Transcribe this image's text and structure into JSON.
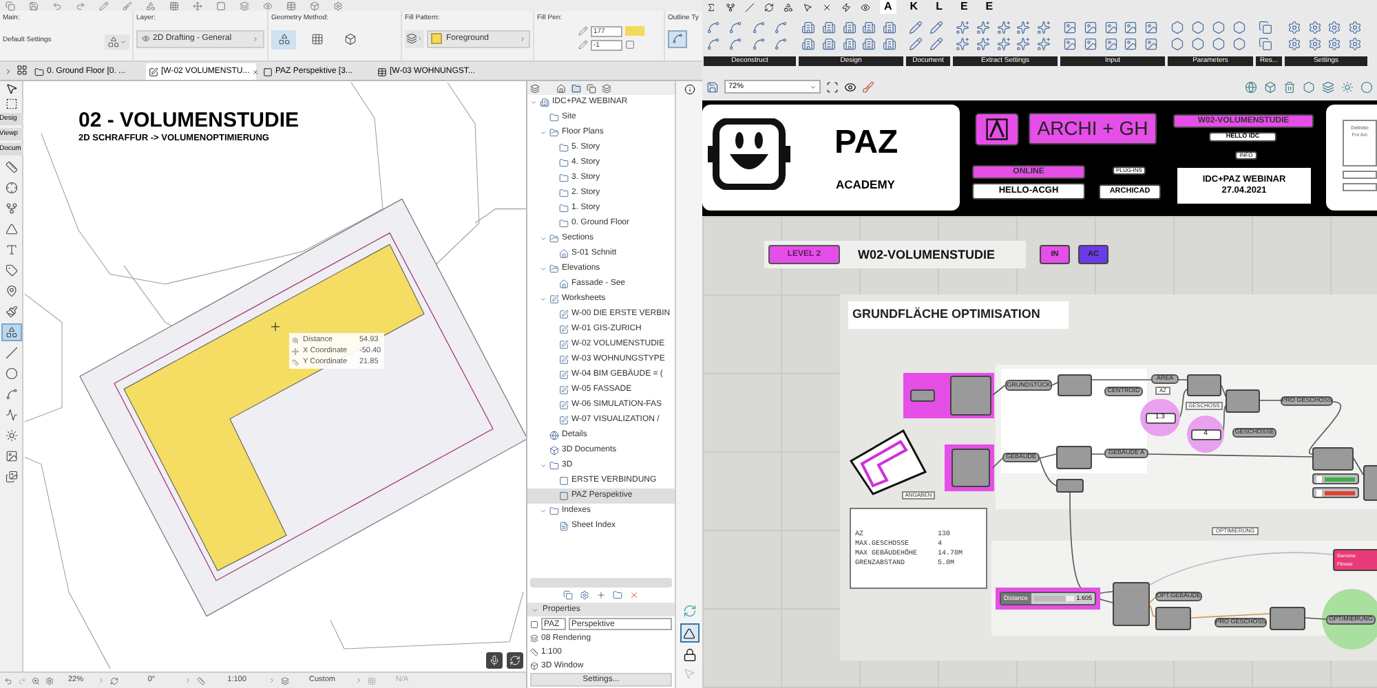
{
  "archicad": {
    "info_box": {
      "main_label": "Main:",
      "main_value": "Default Settings",
      "layer_label": "Layer:",
      "layer_value": "2D Drafting - General",
      "geometry_label": "Geometry Method:",
      "geometry_methods": [
        {
          "selected": true
        },
        {
          "selected": false
        },
        {
          "selected": false
        }
      ],
      "fill_pattern_label": "Fill Pattern:",
      "fill_pattern_value": "Foreground",
      "fill_pen_label": "Fill Pen:",
      "fill_pen": "177",
      "background_pen": "-1",
      "outline_label": "Outline Ty"
    },
    "tabs": [
      {
        "label": "0. Ground Floor [0. ...",
        "kind": "plan",
        "selected": false
      },
      {
        "label": "[W-02 VOLUMENSTU...",
        "kind": "worksheet",
        "selected": true
      },
      {
        "label": "PAZ Perspektive [3...",
        "kind": "view3d",
        "selected": false
      },
      {
        "label": "[W-03 WOHNUNGST...",
        "kind": "table",
        "selected": false
      }
    ],
    "toolbox": {
      "sections": [
        "Desig",
        "Viewp",
        "Docum"
      ],
      "tools": [
        {
          "selected": false
        },
        {
          "selected": false
        },
        {
          "selected": false
        },
        {
          "selected": false
        },
        {
          "selected": false
        },
        {
          "selected": false
        },
        {
          "selected": false
        },
        {
          "selected": false
        },
        {
          "selected": true
        },
        {
          "selected": false
        },
        {
          "selected": false
        },
        {
          "selected": false
        },
        {
          "selected": false
        },
        {
          "selected": false
        },
        {
          "selected": false
        },
        {
          "selected": false
        }
      ]
    },
    "drawing": {
      "title": "02 - VOLUMENSTUDIE",
      "subtitle": "2D SCHRAFFUR -> VOLUMENOPTIMIERUNG"
    },
    "tracker": [
      {
        "label": "Distance",
        "value": "54.93"
      },
      {
        "label": "X Coordinate",
        "value": "-50.40"
      },
      {
        "label": "Y Coordinate",
        "value": "21.85"
      }
    ],
    "status_bar": {
      "zoom": "22%",
      "angle": "0°",
      "scale": "1:100",
      "custom": "Custom",
      "na": "N/A"
    }
  },
  "navigator": {
    "tree": [
      {
        "label": "IDC+PAZ WEBINAR",
        "kind": "project",
        "expanded": true,
        "selected": false,
        "children": [
          {
            "label": "Site",
            "kind": "story",
            "selected": false
          },
          {
            "label": "Floor Plans",
            "kind": "group",
            "expanded": true,
            "selected": false,
            "children": [
              {
                "label": "5. Story",
                "kind": "story",
                "selected": false
              },
              {
                "label": "4. Story",
                "kind": "story",
                "selected": false
              },
              {
                "label": "3. Story",
                "kind": "story",
                "selected": false
              },
              {
                "label": "2. Story",
                "kind": "story",
                "selected": false
              },
              {
                "label": "1. Story",
                "kind": "story",
                "selected": false
              },
              {
                "label": "0. Ground Floor",
                "kind": "story",
                "selected": false
              }
            ]
          },
          {
            "label": "Sections",
            "kind": "group",
            "expanded": true,
            "selected": false,
            "children": [
              {
                "label": "S-01 Schnitt",
                "kind": "section",
                "selected": false
              }
            ]
          },
          {
            "label": "Elevations",
            "kind": "group",
            "expanded": true,
            "selected": false,
            "children": [
              {
                "label": "Fassade - See",
                "kind": "elevation",
                "selected": false
              }
            ]
          },
          {
            "label": "Worksheets",
            "kind": "worksheets",
            "expanded": true,
            "selected": false,
            "children": [
              {
                "label": "W-00 DIE ERSTE VERBIN",
                "kind": "worksheet",
                "selected": false
              },
              {
                "label": "W-01 GIS-ZURICH",
                "kind": "worksheet",
                "selected": false
              },
              {
                "label": "W-02 VOLUMENSTUDIE",
                "kind": "worksheet",
                "selected": false
              },
              {
                "label": "W-03 WOHNUNGSTYPE",
                "kind": "worksheet",
                "selected": false
              },
              {
                "label": "W-04 BIM GEBÄUDE = (",
                "kind": "worksheet",
                "selected": false
              },
              {
                "label": "W-05 FASSADE",
                "kind": "worksheet",
                "selected": false
              },
              {
                "label": "W-06 SIMULATION-FAS",
                "kind": "worksheet",
                "selected": false
              },
              {
                "label": "W-07 VISUALIZATION /",
                "kind": "worksheet",
                "selected": false
              }
            ]
          },
          {
            "label": "Details",
            "kind": "detail",
            "selected": false
          },
          {
            "label": "3D Documents",
            "kind": "doc3d",
            "selected": false
          },
          {
            "label": "3D",
            "kind": "folder",
            "expanded": true,
            "selected": false,
            "children": [
              {
                "label": "ERSTE VERBINDUNG",
                "kind": "view3d",
                "selected": false
              },
              {
                "label": "PAZ Perspektive",
                "kind": "view3d",
                "selected": true
              }
            ]
          },
          {
            "label": "Indexes",
            "kind": "folder",
            "expanded": true,
            "selected": false,
            "children": [
              {
                "label": "Sheet Index",
                "kind": "index",
                "selected": false
              }
            ]
          }
        ]
      }
    ],
    "properties": {
      "title": "Properties",
      "id": "PAZ",
      "name": "Perspektive",
      "rows": [
        "08 Rendering",
        "1:100",
        "3D Window"
      ],
      "settings_button": "Settings..."
    }
  },
  "grasshopper": {
    "tabs": [
      {
        "label": "A",
        "selected": true
      },
      {
        "label": "K",
        "selected": false
      },
      {
        "label": "L",
        "selected": false
      },
      {
        "label": "E",
        "selected": false
      },
      {
        "label": "E",
        "selected": false
      }
    ],
    "ribbon_groups": [
      "Deconstruct",
      "Design",
      "Document",
      "Extract Settings",
      "Input",
      "Parameters",
      "Res...",
      "Settings"
    ],
    "zoom": "72%",
    "banner": {
      "brand": "PAZ",
      "brand_sub": "ACADEMY",
      "archi": "ARCHI + GH",
      "study": "W02-VOLUMENSTUDIE",
      "hello_idc": "HELLO IDC",
      "info": "INFO",
      "online": "ONLINE",
      "hello_acgh": "HELLO-ACGH",
      "plugins": "PLUG-INS",
      "archicad": "ARCHICAD",
      "webinar": "IDC+PAZ WEBINAR",
      "date": "27.04.2021",
      "side_note_1": "Definitio",
      "side_note_2": "For Arc"
    },
    "header": {
      "level": "LEVEL 2",
      "title": "W02-VOLUMENSTUDIE",
      "tags": [
        {
          "label": "IN",
          "color": "#e64ee8"
        },
        {
          "label": "AC",
          "color": "#6a3be6"
        }
      ]
    },
    "group_title": "GRUNDFLÄCHE OPTIMISATION",
    "params": [
      {
        "kind": "tag",
        "text": "GRUNDSTÜCK"
      },
      {
        "kind": "tag",
        "text": "CENTROID"
      },
      {
        "kind": "tag",
        "text": "AREA"
      },
      {
        "kind": "note",
        "text": "AZ"
      },
      {
        "kind": "value",
        "text": "1.3"
      },
      {
        "kind": "note",
        "text": "GESCHOSS"
      },
      {
        "kind": "value",
        "text": "4"
      },
      {
        "kind": "tag",
        "text": "GESCHOSSE"
      },
      {
        "kind": "tag",
        "text": "PRO GESCHOSS"
      },
      {
        "kind": "tag",
        "text": "GEBÄUDE"
      },
      {
        "kind": "tag",
        "text": "GEBÄUDE A"
      },
      {
        "kind": "note",
        "text": "ANGABEN"
      },
      {
        "kind": "note",
        "text": "OPTIMIERUNG"
      },
      {
        "kind": "tag",
        "text": "OPT.GEBÄUDE"
      },
      {
        "kind": "tag",
        "text": "PRO GESCHOSS"
      },
      {
        "kind": "tag",
        "text": "OPTIMIERUNG"
      }
    ],
    "panel_lines": [
      {
        "key": "AZ",
        "value": "130"
      },
      {
        "key": "MAX.GESCHOSSE",
        "value": "4"
      },
      {
        "key": "MAX GEBÄUDEHÖHE",
        "value": "14.70M"
      },
      {
        "key": "GRENZABSTAND",
        "value": "5.0M"
      }
    ],
    "slider": {
      "label": "Distance",
      "value": "1.605",
      "level": 0.8
    },
    "galapagos": {
      "genome": "Genome",
      "fitness": "Fitness"
    },
    "toggles": [
      {
        "color": "#3fae49"
      },
      {
        "color": "#e0402f"
      }
    ]
  }
}
